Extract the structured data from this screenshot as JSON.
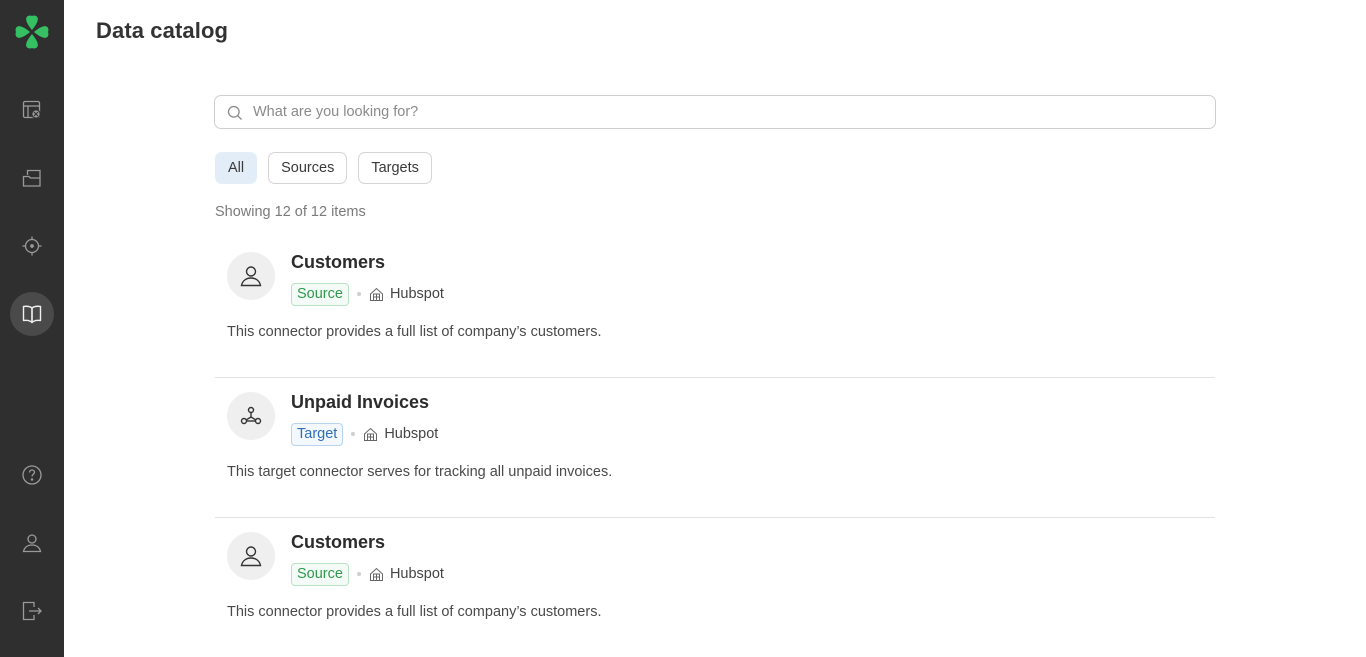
{
  "app": {
    "brand_color": "#35c163",
    "sidebar_bg": "#2f2f2f"
  },
  "sidebar": {
    "logo": "clover-logo-icon",
    "top_items": [
      {
        "name": "dashboard",
        "icon": "table-settings-icon",
        "active": false
      },
      {
        "name": "folders",
        "icon": "folder-open-icon",
        "active": false
      },
      {
        "name": "target",
        "icon": "crosshair-icon",
        "active": false
      },
      {
        "name": "data-catalog",
        "icon": "book-open-icon",
        "active": true
      }
    ],
    "bottom_items": [
      {
        "name": "help",
        "icon": "help-circle-icon"
      },
      {
        "name": "profile",
        "icon": "user-icon"
      },
      {
        "name": "logout",
        "icon": "logout-icon"
      }
    ]
  },
  "header": {
    "title": "Data catalog"
  },
  "search": {
    "placeholder": "What are you looking for?",
    "value": ""
  },
  "filters": [
    {
      "label": "All",
      "active": true
    },
    {
      "label": "Sources",
      "active": false
    },
    {
      "label": "Targets",
      "active": false
    }
  ],
  "results": {
    "count_text": "Showing 12 of 12 items"
  },
  "items": [
    {
      "title": "Customers",
      "type": "Source",
      "icon": "user-icon",
      "provider": "Hubspot",
      "description": "This connector provides a full list of company’s customers."
    },
    {
      "title": "Unpaid Invoices",
      "type": "Target",
      "icon": "webhook-icon",
      "provider": "Hubspot",
      "description": "This target connector serves for tracking all unpaid invoices."
    },
    {
      "title": "Customers",
      "type": "Source",
      "icon": "user-icon",
      "provider": "Hubspot",
      "description": "This connector provides a full list of company’s customers."
    }
  ]
}
